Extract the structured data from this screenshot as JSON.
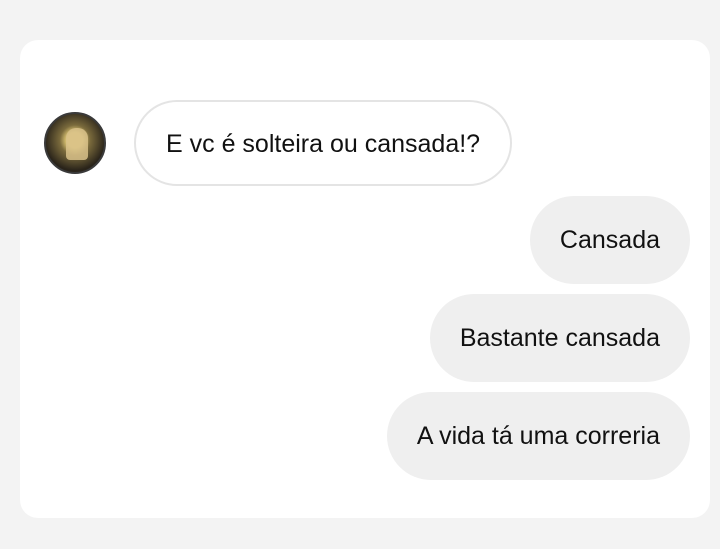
{
  "messages": {
    "incoming": [
      {
        "text": "E vc é solteira ou cansada!?"
      }
    ],
    "outgoing": [
      {
        "text": "Cansada"
      },
      {
        "text": "Bastante cansada"
      },
      {
        "text": "A vida tá uma correria"
      }
    ]
  },
  "colors": {
    "incoming_bubble_bg": "#ffffff",
    "incoming_bubble_border": "#e4e4e4",
    "outgoing_bubble_bg": "#efefef",
    "page_bg": "#f3f3f3"
  },
  "icons": {
    "avatar": "profile-photo"
  }
}
